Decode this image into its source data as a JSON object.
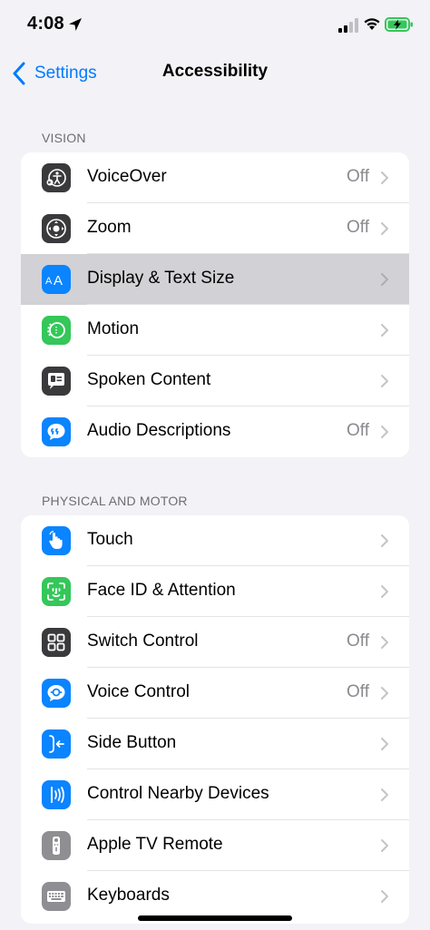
{
  "status_bar": {
    "time": "4:08",
    "location_icon": "location-arrow-icon",
    "signal_icon": "cellular-signal-icon",
    "wifi_icon": "wifi-icon",
    "battery_icon": "battery-charging-icon",
    "battery_color": "#34c759"
  },
  "nav": {
    "back_label": "Settings",
    "title": "Accessibility"
  },
  "accent_color": "#007aff",
  "sections": [
    {
      "header": "VISION",
      "rows": [
        {
          "label": "VoiceOver",
          "value": "Off",
          "icon": "voiceover-icon",
          "icon_color": "#3a3a3c"
        },
        {
          "label": "Zoom",
          "value": "Off",
          "icon": "zoom-icon",
          "icon_color": "#3a3a3c"
        },
        {
          "label": "Display & Text Size",
          "value": "",
          "icon": "text-size-icon",
          "icon_color": "#0a84ff",
          "selected": true
        },
        {
          "label": "Motion",
          "value": "",
          "icon": "motion-icon",
          "icon_color": "#34c759"
        },
        {
          "label": "Spoken Content",
          "value": "",
          "icon": "spoken-content-icon",
          "icon_color": "#3a3a3c"
        },
        {
          "label": "Audio Descriptions",
          "value": "Off",
          "icon": "audio-descriptions-icon",
          "icon_color": "#0a84ff"
        }
      ]
    },
    {
      "header": "PHYSICAL AND MOTOR",
      "rows": [
        {
          "label": "Touch",
          "value": "",
          "icon": "touch-hand-icon",
          "icon_color": "#0a84ff"
        },
        {
          "label": "Face ID & Attention",
          "value": "",
          "icon": "face-id-icon",
          "icon_color": "#34c759"
        },
        {
          "label": "Switch Control",
          "value": "Off",
          "icon": "switch-control-icon",
          "icon_color": "#3a3a3c"
        },
        {
          "label": "Voice Control",
          "value": "Off",
          "icon": "voice-control-icon",
          "icon_color": "#0a84ff"
        },
        {
          "label": "Side Button",
          "value": "",
          "icon": "side-button-icon",
          "icon_color": "#0a84ff"
        },
        {
          "label": "Control Nearby Devices",
          "value": "",
          "icon": "nearby-devices-icon",
          "icon_color": "#0a84ff"
        },
        {
          "label": "Apple TV Remote",
          "value": "",
          "icon": "tv-remote-icon",
          "icon_color": "#8e8e93"
        },
        {
          "label": "Keyboards",
          "value": "",
          "icon": "keyboard-icon",
          "icon_color": "#8e8e93"
        }
      ]
    }
  ]
}
